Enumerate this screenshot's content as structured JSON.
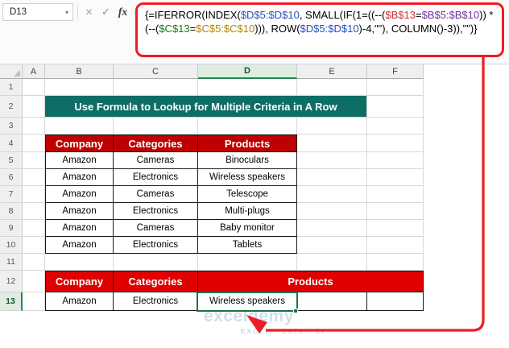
{
  "colors": {
    "annotation": "#EE1C25",
    "title_bg": "#0E6E66",
    "header1_bg": "#C00000",
    "header2_bg": "#E00000",
    "selection": "#1E7145",
    "watermark": "#A9C6E0"
  },
  "formula_bar": {
    "name_box": "D13",
    "dropdown_icon": "▾",
    "cancel_icon": "✕",
    "enter_icon": "✓",
    "fx_icon": "fx",
    "formula": "{=IFERROR(INDEX($D$5:$D$10, SMALL(IF(1=((--($B$13=$B$5:$B$10)) * (--($C$13=$C$5:$C$10))), ROW($D$5:$D$10)-4,\"\"), COLUMN()-3)),\"\")}",
    "segments": [
      {
        "text": "{=IFERROR(INDEX(",
        "color": "#000000"
      },
      {
        "text": "$D$5:$D$10",
        "color": "#2550C0"
      },
      {
        "text": ", SMALL(IF(1=((--(",
        "color": "#000000"
      },
      {
        "text": "$B$13",
        "color": "#D92B2B"
      },
      {
        "text": "=",
        "color": "#000000"
      },
      {
        "text": "$B$5:$B$10",
        "color": "#7030A0"
      },
      {
        "text": ")) * (--(",
        "color": "#000000"
      },
      {
        "text": "$C$13",
        "color": "#107C10"
      },
      {
        "text": "=",
        "color": "#000000"
      },
      {
        "text": "$C$5:$C$10",
        "color": "#B8860B"
      },
      {
        "text": "))), ROW(",
        "color": "#000000"
      },
      {
        "text": "$D$5:$D$10",
        "color": "#2550C0"
      },
      {
        "text": ")-4,\"\"), COLUMN()-3)),\"\")}",
        "color": "#000000"
      }
    ]
  },
  "sheet": {
    "columns": [
      "A",
      "B",
      "C",
      "D",
      "E",
      "F"
    ],
    "row_numbers": [
      "1",
      "2",
      "3",
      "4",
      "5",
      "6",
      "7",
      "8",
      "9",
      "10",
      "11",
      "12",
      "13"
    ],
    "selected_cell": "D13"
  },
  "content": {
    "title": "Use Formula to Lookup for Multiple Criteria in A Row",
    "table1": {
      "headers": [
        "Company",
        "Categories",
        "Products"
      ],
      "rows": [
        [
          "Amazon",
          "Cameras",
          "Binoculars"
        ],
        [
          "Amazon",
          "Electronics",
          "Wireless speakers"
        ],
        [
          "Amazon",
          "Cameras",
          "Telescope"
        ],
        [
          "Amazon",
          "Electronics",
          "Multi-plugs"
        ],
        [
          "Amazon",
          "Cameras",
          "Baby monitor"
        ],
        [
          "Amazon",
          "Electronics",
          "Tablets"
        ]
      ]
    },
    "table2": {
      "headers": [
        "Company",
        "Categories",
        "Products"
      ],
      "rows": [
        [
          "Amazon",
          "Electronics",
          "Wireless speakers"
        ]
      ]
    },
    "watermark": {
      "brand": "exceldemy",
      "tagline": "EXCEL · DATA · BI"
    }
  }
}
